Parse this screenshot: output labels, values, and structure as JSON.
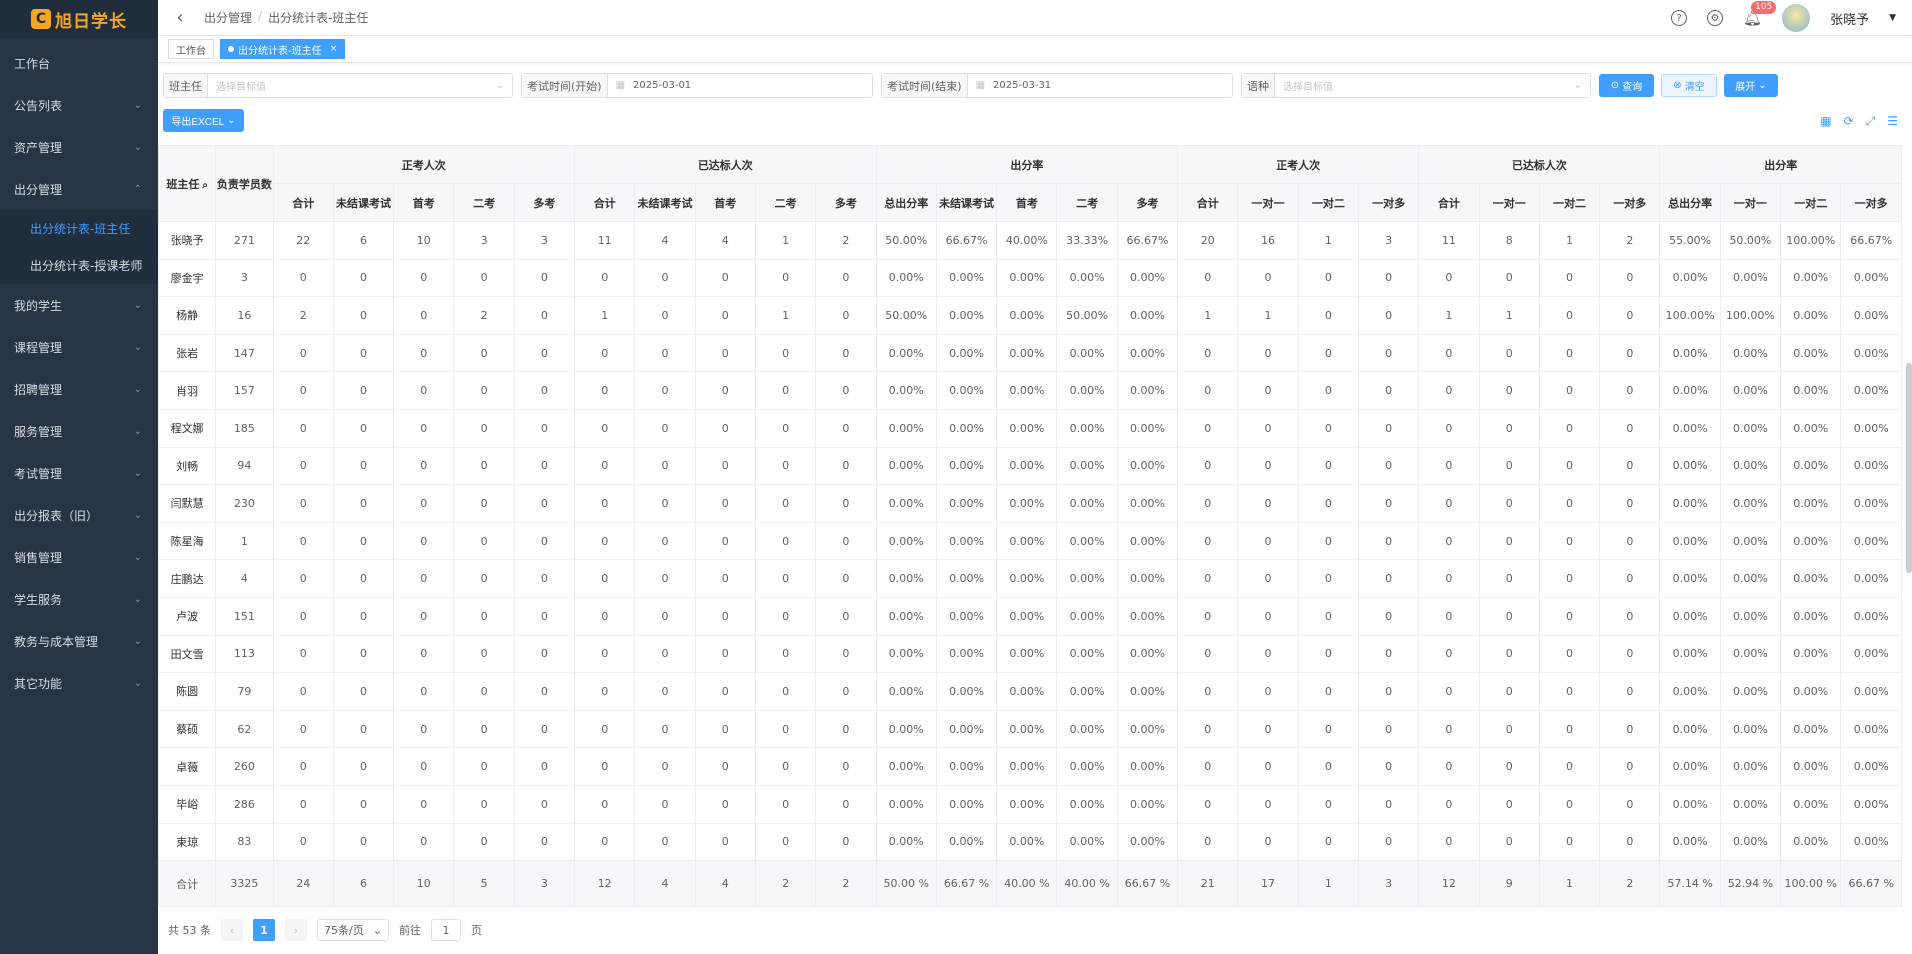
{
  "app": {
    "logo_mark": "C",
    "logo_text": "旭日学长"
  },
  "sidebar": {
    "items": [
      {
        "label": "工作台",
        "has_children": false
      },
      {
        "label": "公告列表",
        "has_children": true
      },
      {
        "label": "资产管理",
        "has_children": true
      },
      {
        "label": "出分管理",
        "has_children": true,
        "expanded": true
      },
      {
        "label": "我的学生",
        "has_children": true
      },
      {
        "label": "课程管理",
        "has_children": true
      },
      {
        "label": "招聘管理",
        "has_children": true
      },
      {
        "label": "服务管理",
        "has_children": true
      },
      {
        "label": "考试管理",
        "has_children": true
      },
      {
        "label": "出分报表（旧）",
        "has_children": true
      },
      {
        "label": "销售管理",
        "has_children": true
      },
      {
        "label": "学生服务",
        "has_children": true
      },
      {
        "label": "教务与成本管理",
        "has_children": true
      },
      {
        "label": "其它功能",
        "has_children": true
      }
    ],
    "submenu": [
      {
        "label": "出分统计表-班主任",
        "active": true
      },
      {
        "label": "出分统计表-授课老师",
        "active": false
      }
    ]
  },
  "header": {
    "breadcrumb": [
      "出分管理",
      "出分统计表-班主任"
    ],
    "notifications": "105",
    "user": "张晓予"
  },
  "tags": [
    {
      "label": "工作台",
      "active": false
    },
    {
      "label": "出分统计表-班主任",
      "active": true
    }
  ],
  "filters": {
    "teacher_label": "班主任",
    "teacher_placeholder": "选择目标值",
    "start_label": "考试时间(开始)",
    "start_value": "2025-03-01",
    "end_label": "考试时间(结束)",
    "end_value": "2025-03-31",
    "lang_label": "语种",
    "lang_placeholder": "选择目标值",
    "search_btn": "查询",
    "clear_btn": "清空",
    "expand_btn": "展开",
    "export_btn": "导出EXCEL"
  },
  "table": {
    "header_name": "班主任",
    "header_count": "负责学员数",
    "groups": [
      {
        "label": "正考人次",
        "cols": [
          "合计",
          "未结课考试",
          "首考",
          "二考",
          "多考"
        ]
      },
      {
        "label": "已达标人次",
        "cols": [
          "合计",
          "未结课考试",
          "首考",
          "二考",
          "多考"
        ]
      },
      {
        "label": "出分率",
        "cols": [
          "总出分率",
          "未结课考试",
          "首考",
          "二考",
          "多考"
        ]
      },
      {
        "label": "正考人次",
        "cols": [
          "合计",
          "一对一",
          "一对二",
          "一对多"
        ]
      },
      {
        "label": "已达标人次",
        "cols": [
          "合计",
          "一对一",
          "一对二",
          "一对多"
        ]
      },
      {
        "label": "出分率",
        "cols": [
          "总出分率",
          "一对一",
          "一对二",
          "一对多"
        ]
      }
    ],
    "rows": [
      [
        "张晓予",
        "271",
        "22",
        "6",
        "10",
        "3",
        "3",
        "11",
        "4",
        "4",
        "1",
        "2",
        "50.00%",
        "66.67%",
        "40.00%",
        "33.33%",
        "66.67%",
        "20",
        "16",
        "1",
        "3",
        "11",
        "8",
        "1",
        "2",
        "55.00%",
        "50.00%",
        "100.00%",
        "66.67%"
      ],
      [
        "廖金宇",
        "3",
        "0",
        "0",
        "0",
        "0",
        "0",
        "0",
        "0",
        "0",
        "0",
        "0",
        "0.00%",
        "0.00%",
        "0.00%",
        "0.00%",
        "0.00%",
        "0",
        "0",
        "0",
        "0",
        "0",
        "0",
        "0",
        "0",
        "0.00%",
        "0.00%",
        "0.00%",
        "0.00%"
      ],
      [
        "杨静",
        "16",
        "2",
        "0",
        "0",
        "2",
        "0",
        "1",
        "0",
        "0",
        "1",
        "0",
        "50.00%",
        "0.00%",
        "0.00%",
        "50.00%",
        "0.00%",
        "1",
        "1",
        "0",
        "0",
        "1",
        "1",
        "0",
        "0",
        "100.00%",
        "100.00%",
        "0.00%",
        "0.00%"
      ],
      [
        "张岩",
        "147",
        "0",
        "0",
        "0",
        "0",
        "0",
        "0",
        "0",
        "0",
        "0",
        "0",
        "0.00%",
        "0.00%",
        "0.00%",
        "0.00%",
        "0.00%",
        "0",
        "0",
        "0",
        "0",
        "0",
        "0",
        "0",
        "0",
        "0.00%",
        "0.00%",
        "0.00%",
        "0.00%"
      ],
      [
        "肖羽",
        "157",
        "0",
        "0",
        "0",
        "0",
        "0",
        "0",
        "0",
        "0",
        "0",
        "0",
        "0.00%",
        "0.00%",
        "0.00%",
        "0.00%",
        "0.00%",
        "0",
        "0",
        "0",
        "0",
        "0",
        "0",
        "0",
        "0",
        "0.00%",
        "0.00%",
        "0.00%",
        "0.00%"
      ],
      [
        "程文娜",
        "185",
        "0",
        "0",
        "0",
        "0",
        "0",
        "0",
        "0",
        "0",
        "0",
        "0",
        "0.00%",
        "0.00%",
        "0.00%",
        "0.00%",
        "0.00%",
        "0",
        "0",
        "0",
        "0",
        "0",
        "0",
        "0",
        "0",
        "0.00%",
        "0.00%",
        "0.00%",
        "0.00%"
      ],
      [
        "刘畅",
        "94",
        "0",
        "0",
        "0",
        "0",
        "0",
        "0",
        "0",
        "0",
        "0",
        "0",
        "0.00%",
        "0.00%",
        "0.00%",
        "0.00%",
        "0.00%",
        "0",
        "0",
        "0",
        "0",
        "0",
        "0",
        "0",
        "0",
        "0.00%",
        "0.00%",
        "0.00%",
        "0.00%"
      ],
      [
        "闫默慧",
        "230",
        "0",
        "0",
        "0",
        "0",
        "0",
        "0",
        "0",
        "0",
        "0",
        "0",
        "0.00%",
        "0.00%",
        "0.00%",
        "0.00%",
        "0.00%",
        "0",
        "0",
        "0",
        "0",
        "0",
        "0",
        "0",
        "0",
        "0.00%",
        "0.00%",
        "0.00%",
        "0.00%"
      ],
      [
        "陈星海",
        "1",
        "0",
        "0",
        "0",
        "0",
        "0",
        "0",
        "0",
        "0",
        "0",
        "0",
        "0.00%",
        "0.00%",
        "0.00%",
        "0.00%",
        "0.00%",
        "0",
        "0",
        "0",
        "0",
        "0",
        "0",
        "0",
        "0",
        "0.00%",
        "0.00%",
        "0.00%",
        "0.00%"
      ],
      [
        "庄鹏达",
        "4",
        "0",
        "0",
        "0",
        "0",
        "0",
        "0",
        "0",
        "0",
        "0",
        "0",
        "0.00%",
        "0.00%",
        "0.00%",
        "0.00%",
        "0.00%",
        "0",
        "0",
        "0",
        "0",
        "0",
        "0",
        "0",
        "0",
        "0.00%",
        "0.00%",
        "0.00%",
        "0.00%"
      ],
      [
        "卢波",
        "151",
        "0",
        "0",
        "0",
        "0",
        "0",
        "0",
        "0",
        "0",
        "0",
        "0",
        "0.00%",
        "0.00%",
        "0.00%",
        "0.00%",
        "0.00%",
        "0",
        "0",
        "0",
        "0",
        "0",
        "0",
        "0",
        "0",
        "0.00%",
        "0.00%",
        "0.00%",
        "0.00%"
      ],
      [
        "田文雪",
        "113",
        "0",
        "0",
        "0",
        "0",
        "0",
        "0",
        "0",
        "0",
        "0",
        "0",
        "0.00%",
        "0.00%",
        "0.00%",
        "0.00%",
        "0.00%",
        "0",
        "0",
        "0",
        "0",
        "0",
        "0",
        "0",
        "0",
        "0.00%",
        "0.00%",
        "0.00%",
        "0.00%"
      ],
      [
        "陈圆",
        "79",
        "0",
        "0",
        "0",
        "0",
        "0",
        "0",
        "0",
        "0",
        "0",
        "0",
        "0.00%",
        "0.00%",
        "0.00%",
        "0.00%",
        "0.00%",
        "0",
        "0",
        "0",
        "0",
        "0",
        "0",
        "0",
        "0",
        "0.00%",
        "0.00%",
        "0.00%",
        "0.00%"
      ],
      [
        "蔡硕",
        "62",
        "0",
        "0",
        "0",
        "0",
        "0",
        "0",
        "0",
        "0",
        "0",
        "0",
        "0.00%",
        "0.00%",
        "0.00%",
        "0.00%",
        "0.00%",
        "0",
        "0",
        "0",
        "0",
        "0",
        "0",
        "0",
        "0",
        "0.00%",
        "0.00%",
        "0.00%",
        "0.00%"
      ],
      [
        "卓薇",
        "260",
        "0",
        "0",
        "0",
        "0",
        "0",
        "0",
        "0",
        "0",
        "0",
        "0",
        "0.00%",
        "0.00%",
        "0.00%",
        "0.00%",
        "0.00%",
        "0",
        "0",
        "0",
        "0",
        "0",
        "0",
        "0",
        "0",
        "0.00%",
        "0.00%",
        "0.00%",
        "0.00%"
      ],
      [
        "毕峪",
        "286",
        "0",
        "0",
        "0",
        "0",
        "0",
        "0",
        "0",
        "0",
        "0",
        "0",
        "0.00%",
        "0.00%",
        "0.00%",
        "0.00%",
        "0.00%",
        "0",
        "0",
        "0",
        "0",
        "0",
        "0",
        "0",
        "0",
        "0.00%",
        "0.00%",
        "0.00%",
        "0.00%"
      ],
      [
        "束琼",
        "83",
        "0",
        "0",
        "0",
        "0",
        "0",
        "0",
        "0",
        "0",
        "0",
        "0",
        "0.00%",
        "0.00%",
        "0.00%",
        "0.00%",
        "0.00%",
        "0",
        "0",
        "0",
        "0",
        "0",
        "0",
        "0",
        "0",
        "0.00%",
        "0.00%",
        "0.00%",
        "0.00%"
      ]
    ],
    "total": [
      "合计",
      "3325",
      "24",
      "6",
      "10",
      "5",
      "3",
      "12",
      "4",
      "4",
      "2",
      "2",
      "50.00 %",
      "66.67 %",
      "40.00 %",
      "40.00 %",
      "66.67 %",
      "21",
      "17",
      "1",
      "3",
      "12",
      "9",
      "1",
      "2",
      "57.14 %",
      "52.94 %",
      "100.00 %",
      "66.67 %"
    ]
  },
  "pager": {
    "total_text": "共 53 条",
    "current_page": "1",
    "page_size": "75条/页",
    "goto_label": "前往",
    "goto_value": "1",
    "page_unit": "页"
  },
  "colors": {
    "sidebar_bg": "#263445",
    "accent": "#409eff",
    "brand": "#f5a623"
  }
}
